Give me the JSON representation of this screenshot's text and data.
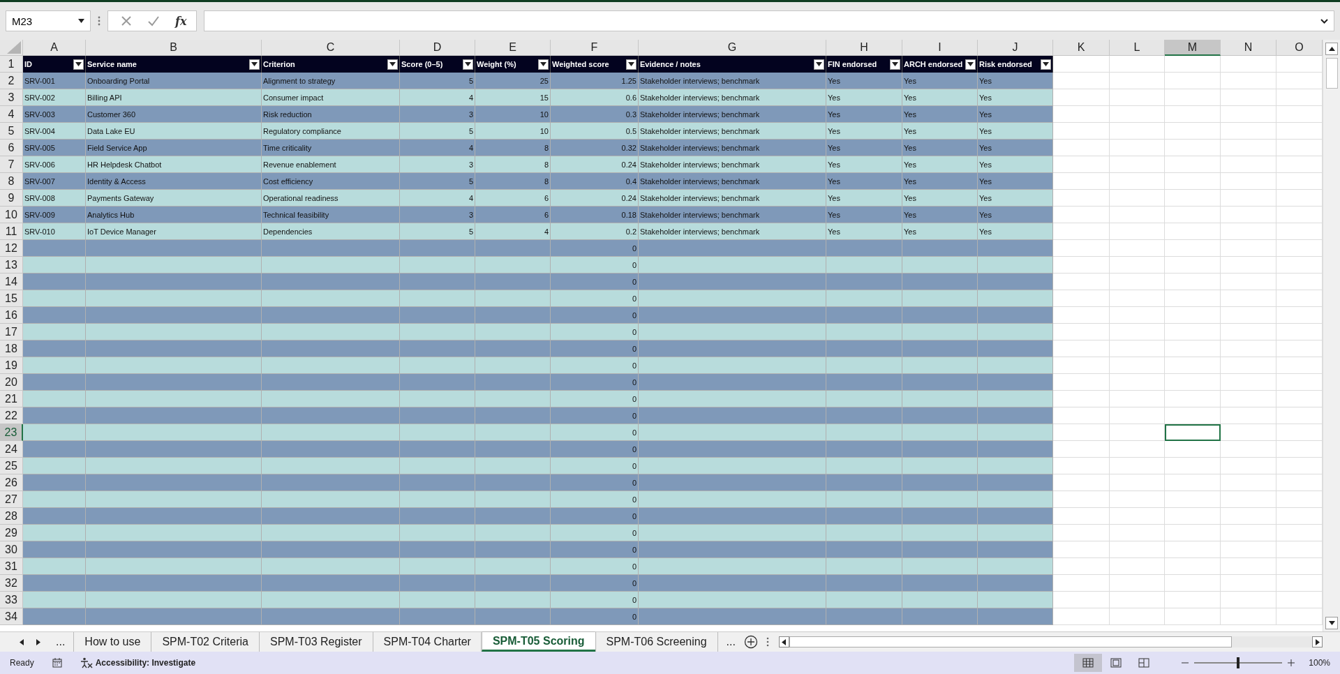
{
  "name_box": {
    "value": "M23"
  },
  "formula_bar": {
    "function_label": "fx"
  },
  "columns": [
    {
      "letter": "A",
      "selected": false
    },
    {
      "letter": "B",
      "selected": false
    },
    {
      "letter": "C",
      "selected": false
    },
    {
      "letter": "D",
      "selected": false
    },
    {
      "letter": "E",
      "selected": false
    },
    {
      "letter": "F",
      "selected": false
    },
    {
      "letter": "G",
      "selected": false
    },
    {
      "letter": "H",
      "selected": false
    },
    {
      "letter": "I",
      "selected": false
    },
    {
      "letter": "J",
      "selected": false
    },
    {
      "letter": "K",
      "selected": false
    },
    {
      "letter": "L",
      "selected": false
    },
    {
      "letter": "M",
      "selected": true
    },
    {
      "letter": "N",
      "selected": false
    },
    {
      "letter": "O",
      "selected": false
    }
  ],
  "table": {
    "header_row": "1",
    "headers": [
      {
        "label": "ID",
        "numeric": false
      },
      {
        "label": "Service name",
        "numeric": false
      },
      {
        "label": "Criterion",
        "numeric": false
      },
      {
        "label": "Score (0–5)",
        "numeric": true
      },
      {
        "label": "Weight (%)",
        "numeric": true
      },
      {
        "label": "Weighted score",
        "numeric": true
      },
      {
        "label": "Evidence / notes",
        "numeric": false
      },
      {
        "label": "FIN endorsed",
        "numeric": false
      },
      {
        "label": "ARCH endorsed",
        "numeric": false
      },
      {
        "label": "Risk endorsed",
        "numeric": false
      }
    ],
    "rows": [
      {
        "row": "2",
        "selected": false,
        "cells": [
          "SRV-001",
          "Onboarding Portal",
          "Alignment to strategy",
          "5",
          "25",
          "1.25",
          "Stakeholder interviews; benchmark",
          "Yes",
          "Yes",
          "Yes"
        ]
      },
      {
        "row": "3",
        "selected": false,
        "cells": [
          "SRV-002",
          "Billing API",
          "Consumer impact",
          "4",
          "15",
          "0.6",
          "Stakeholder interviews; benchmark",
          "Yes",
          "Yes",
          "Yes"
        ]
      },
      {
        "row": "4",
        "selected": false,
        "cells": [
          "SRV-003",
          "Customer 360",
          "Risk reduction",
          "3",
          "10",
          "0.3",
          "Stakeholder interviews; benchmark",
          "Yes",
          "Yes",
          "Yes"
        ]
      },
      {
        "row": "5",
        "selected": false,
        "cells": [
          "SRV-004",
          "Data Lake EU",
          "Regulatory compliance",
          "5",
          "10",
          "0.5",
          "Stakeholder interviews; benchmark",
          "Yes",
          "Yes",
          "Yes"
        ]
      },
      {
        "row": "6",
        "selected": false,
        "cells": [
          "SRV-005",
          "Field Service App",
          "Time criticality",
          "4",
          "8",
          "0.32",
          "Stakeholder interviews; benchmark",
          "Yes",
          "Yes",
          "Yes"
        ]
      },
      {
        "row": "7",
        "selected": false,
        "cells": [
          "SRV-006",
          "HR Helpdesk Chatbot",
          "Revenue enablement",
          "3",
          "8",
          "0.24",
          "Stakeholder interviews; benchmark",
          "Yes",
          "Yes",
          "Yes"
        ]
      },
      {
        "row": "8",
        "selected": false,
        "cells": [
          "SRV-007",
          "Identity & Access",
          "Cost efficiency",
          "5",
          "8",
          "0.4",
          "Stakeholder interviews; benchmark",
          "Yes",
          "Yes",
          "Yes"
        ]
      },
      {
        "row": "9",
        "selected": false,
        "cells": [
          "SRV-008",
          "Payments Gateway",
          "Operational readiness",
          "4",
          "6",
          "0.24",
          "Stakeholder interviews; benchmark",
          "Yes",
          "Yes",
          "Yes"
        ]
      },
      {
        "row": "10",
        "selected": false,
        "cells": [
          "SRV-009",
          "Analytics Hub",
          "Technical feasibility",
          "3",
          "6",
          "0.18",
          "Stakeholder interviews; benchmark",
          "Yes",
          "Yes",
          "Yes"
        ]
      },
      {
        "row": "11",
        "selected": false,
        "cells": [
          "SRV-010",
          "IoT Device Manager",
          "Dependencies",
          "5",
          "4",
          "0.2",
          "Stakeholder interviews; benchmark",
          "Yes",
          "Yes",
          "Yes"
        ]
      },
      {
        "row": "12",
        "selected": false,
        "cells": [
          null,
          null,
          null,
          null,
          null,
          "0",
          null,
          null,
          null,
          null
        ]
      },
      {
        "row": "13",
        "selected": false,
        "cells": [
          null,
          null,
          null,
          null,
          null,
          "0",
          null,
          null,
          null,
          null
        ]
      },
      {
        "row": "14",
        "selected": false,
        "cells": [
          null,
          null,
          null,
          null,
          null,
          "0",
          null,
          null,
          null,
          null
        ]
      },
      {
        "row": "15",
        "selected": false,
        "cells": [
          null,
          null,
          null,
          null,
          null,
          "0",
          null,
          null,
          null,
          null
        ]
      },
      {
        "row": "16",
        "selected": false,
        "cells": [
          null,
          null,
          null,
          null,
          null,
          "0",
          null,
          null,
          null,
          null
        ]
      },
      {
        "row": "17",
        "selected": false,
        "cells": [
          null,
          null,
          null,
          null,
          null,
          "0",
          null,
          null,
          null,
          null
        ]
      },
      {
        "row": "18",
        "selected": false,
        "cells": [
          null,
          null,
          null,
          null,
          null,
          "0",
          null,
          null,
          null,
          null
        ]
      },
      {
        "row": "19",
        "selected": false,
        "cells": [
          null,
          null,
          null,
          null,
          null,
          "0",
          null,
          null,
          null,
          null
        ]
      },
      {
        "row": "20",
        "selected": false,
        "cells": [
          null,
          null,
          null,
          null,
          null,
          "0",
          null,
          null,
          null,
          null
        ]
      },
      {
        "row": "21",
        "selected": false,
        "cells": [
          null,
          null,
          null,
          null,
          null,
          "0",
          null,
          null,
          null,
          null
        ]
      },
      {
        "row": "22",
        "selected": false,
        "cells": [
          null,
          null,
          null,
          null,
          null,
          "0",
          null,
          null,
          null,
          null
        ]
      },
      {
        "row": "23",
        "selected": true,
        "cells": [
          null,
          null,
          null,
          null,
          null,
          "0",
          null,
          null,
          null,
          null
        ]
      },
      {
        "row": "24",
        "selected": false,
        "cells": [
          null,
          null,
          null,
          null,
          null,
          "0",
          null,
          null,
          null,
          null
        ]
      },
      {
        "row": "25",
        "selected": false,
        "cells": [
          null,
          null,
          null,
          null,
          null,
          "0",
          null,
          null,
          null,
          null
        ]
      },
      {
        "row": "26",
        "selected": false,
        "cells": [
          null,
          null,
          null,
          null,
          null,
          "0",
          null,
          null,
          null,
          null
        ]
      },
      {
        "row": "27",
        "selected": false,
        "cells": [
          null,
          null,
          null,
          null,
          null,
          "0",
          null,
          null,
          null,
          null
        ]
      },
      {
        "row": "28",
        "selected": false,
        "cells": [
          null,
          null,
          null,
          null,
          null,
          "0",
          null,
          null,
          null,
          null
        ]
      },
      {
        "row": "29",
        "selected": false,
        "cells": [
          null,
          null,
          null,
          null,
          null,
          "0",
          null,
          null,
          null,
          null
        ]
      },
      {
        "row": "30",
        "selected": false,
        "cells": [
          null,
          null,
          null,
          null,
          null,
          "0",
          null,
          null,
          null,
          null
        ]
      },
      {
        "row": "31",
        "selected": false,
        "cells": [
          null,
          null,
          null,
          null,
          null,
          "0",
          null,
          null,
          null,
          null
        ]
      },
      {
        "row": "32",
        "selected": false,
        "cells": [
          null,
          null,
          null,
          null,
          null,
          "0",
          null,
          null,
          null,
          null
        ]
      },
      {
        "row": "33",
        "selected": false,
        "cells": [
          null,
          null,
          null,
          null,
          null,
          "0",
          null,
          null,
          null,
          null
        ]
      },
      {
        "row": "34",
        "selected": false,
        "cells": [
          null,
          null,
          null,
          null,
          null,
          "0",
          null,
          null,
          null,
          null
        ]
      }
    ]
  },
  "sheet_tabs": {
    "overflow_left": "...",
    "tabs": [
      {
        "label": "How to use",
        "selected": false
      },
      {
        "label": "SPM-T02 Criteria",
        "selected": false
      },
      {
        "label": "SPM-T03 Register",
        "selected": false
      },
      {
        "label": "SPM-T04 Charter",
        "selected": false
      },
      {
        "label": "SPM-T05 Scoring",
        "selected": true
      },
      {
        "label": "SPM-T06 Screening",
        "selected": false
      }
    ],
    "overflow_right": "..."
  },
  "status_bar": {
    "mode": "Ready",
    "accessibility": "Accessibility: Investigate",
    "views": [
      {
        "kind": "normal",
        "selected": true
      },
      {
        "kind": "page_layout",
        "selected": false
      },
      {
        "kind": "page_break",
        "selected": false
      }
    ],
    "zoom": {
      "level": 0.5,
      "label": "100%"
    }
  }
}
